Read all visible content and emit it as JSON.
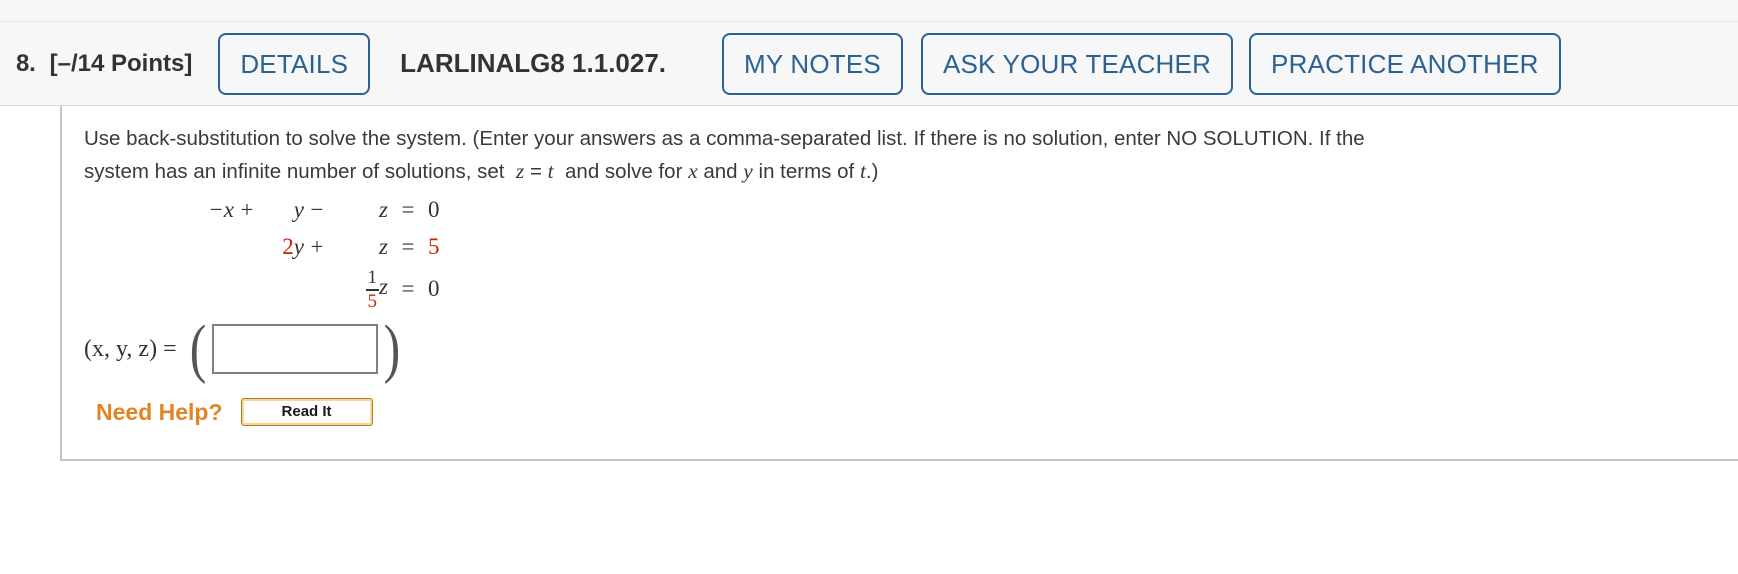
{
  "header": {
    "question_number": "8.",
    "points": "[–/14 Points]",
    "details_label": "DETAILS",
    "question_code": "LARLINALG8 1.1.027.",
    "my_notes_label": "MY NOTES",
    "ask_teacher_label": "ASK YOUR TEACHER",
    "practice_another_label": "PRACTICE ANOTHER",
    "accent_color": "#2b6295"
  },
  "content": {
    "prompt_line1": "Use back-substitution to solve the system. (Enter your answers as a comma-separated list. If there is no solution, enter NO SOLUTION. If the",
    "prompt_line2_a": "system has an infinite number of solutions, set",
    "prompt_line2_z": "z",
    "prompt_line2_eq": "=",
    "prompt_line2_t": "t",
    "prompt_line2_b": "and solve for",
    "prompt_line2_x": "x",
    "prompt_line2_and": "and",
    "prompt_line2_y": "y",
    "prompt_line2_c": "in terms of",
    "prompt_line2_t2": "t",
    "prompt_line2_end": ".)",
    "equations": [
      {
        "x": "−x",
        "op1": "+",
        "y": "y",
        "op2": "−",
        "z": "z",
        "eq": "=",
        "rhs": "0",
        "x_red": false,
        "y_coef_red": false,
        "rhs_red": false
      },
      {
        "x": "",
        "op1": "",
        "y_coef": "2",
        "y": "y",
        "op2": "+",
        "z": "z",
        "eq": "=",
        "rhs": "5",
        "y_coef_red": true,
        "rhs_red": true
      },
      {
        "frac_num": "1",
        "frac_den": "5",
        "z": "z",
        "eq": "=",
        "rhs": "0",
        "frac_den_red": true,
        "rhs_red": false
      }
    ],
    "answer_label": "(x, y, z) =",
    "answer_open_paren": "(",
    "answer_close_paren": ")",
    "answer_value": "",
    "answer_placeholder": "",
    "need_help_label": "Need Help?",
    "read_it_label": "Read It",
    "need_help_color": "#e08424",
    "highlight_color": "#cc2200"
  }
}
